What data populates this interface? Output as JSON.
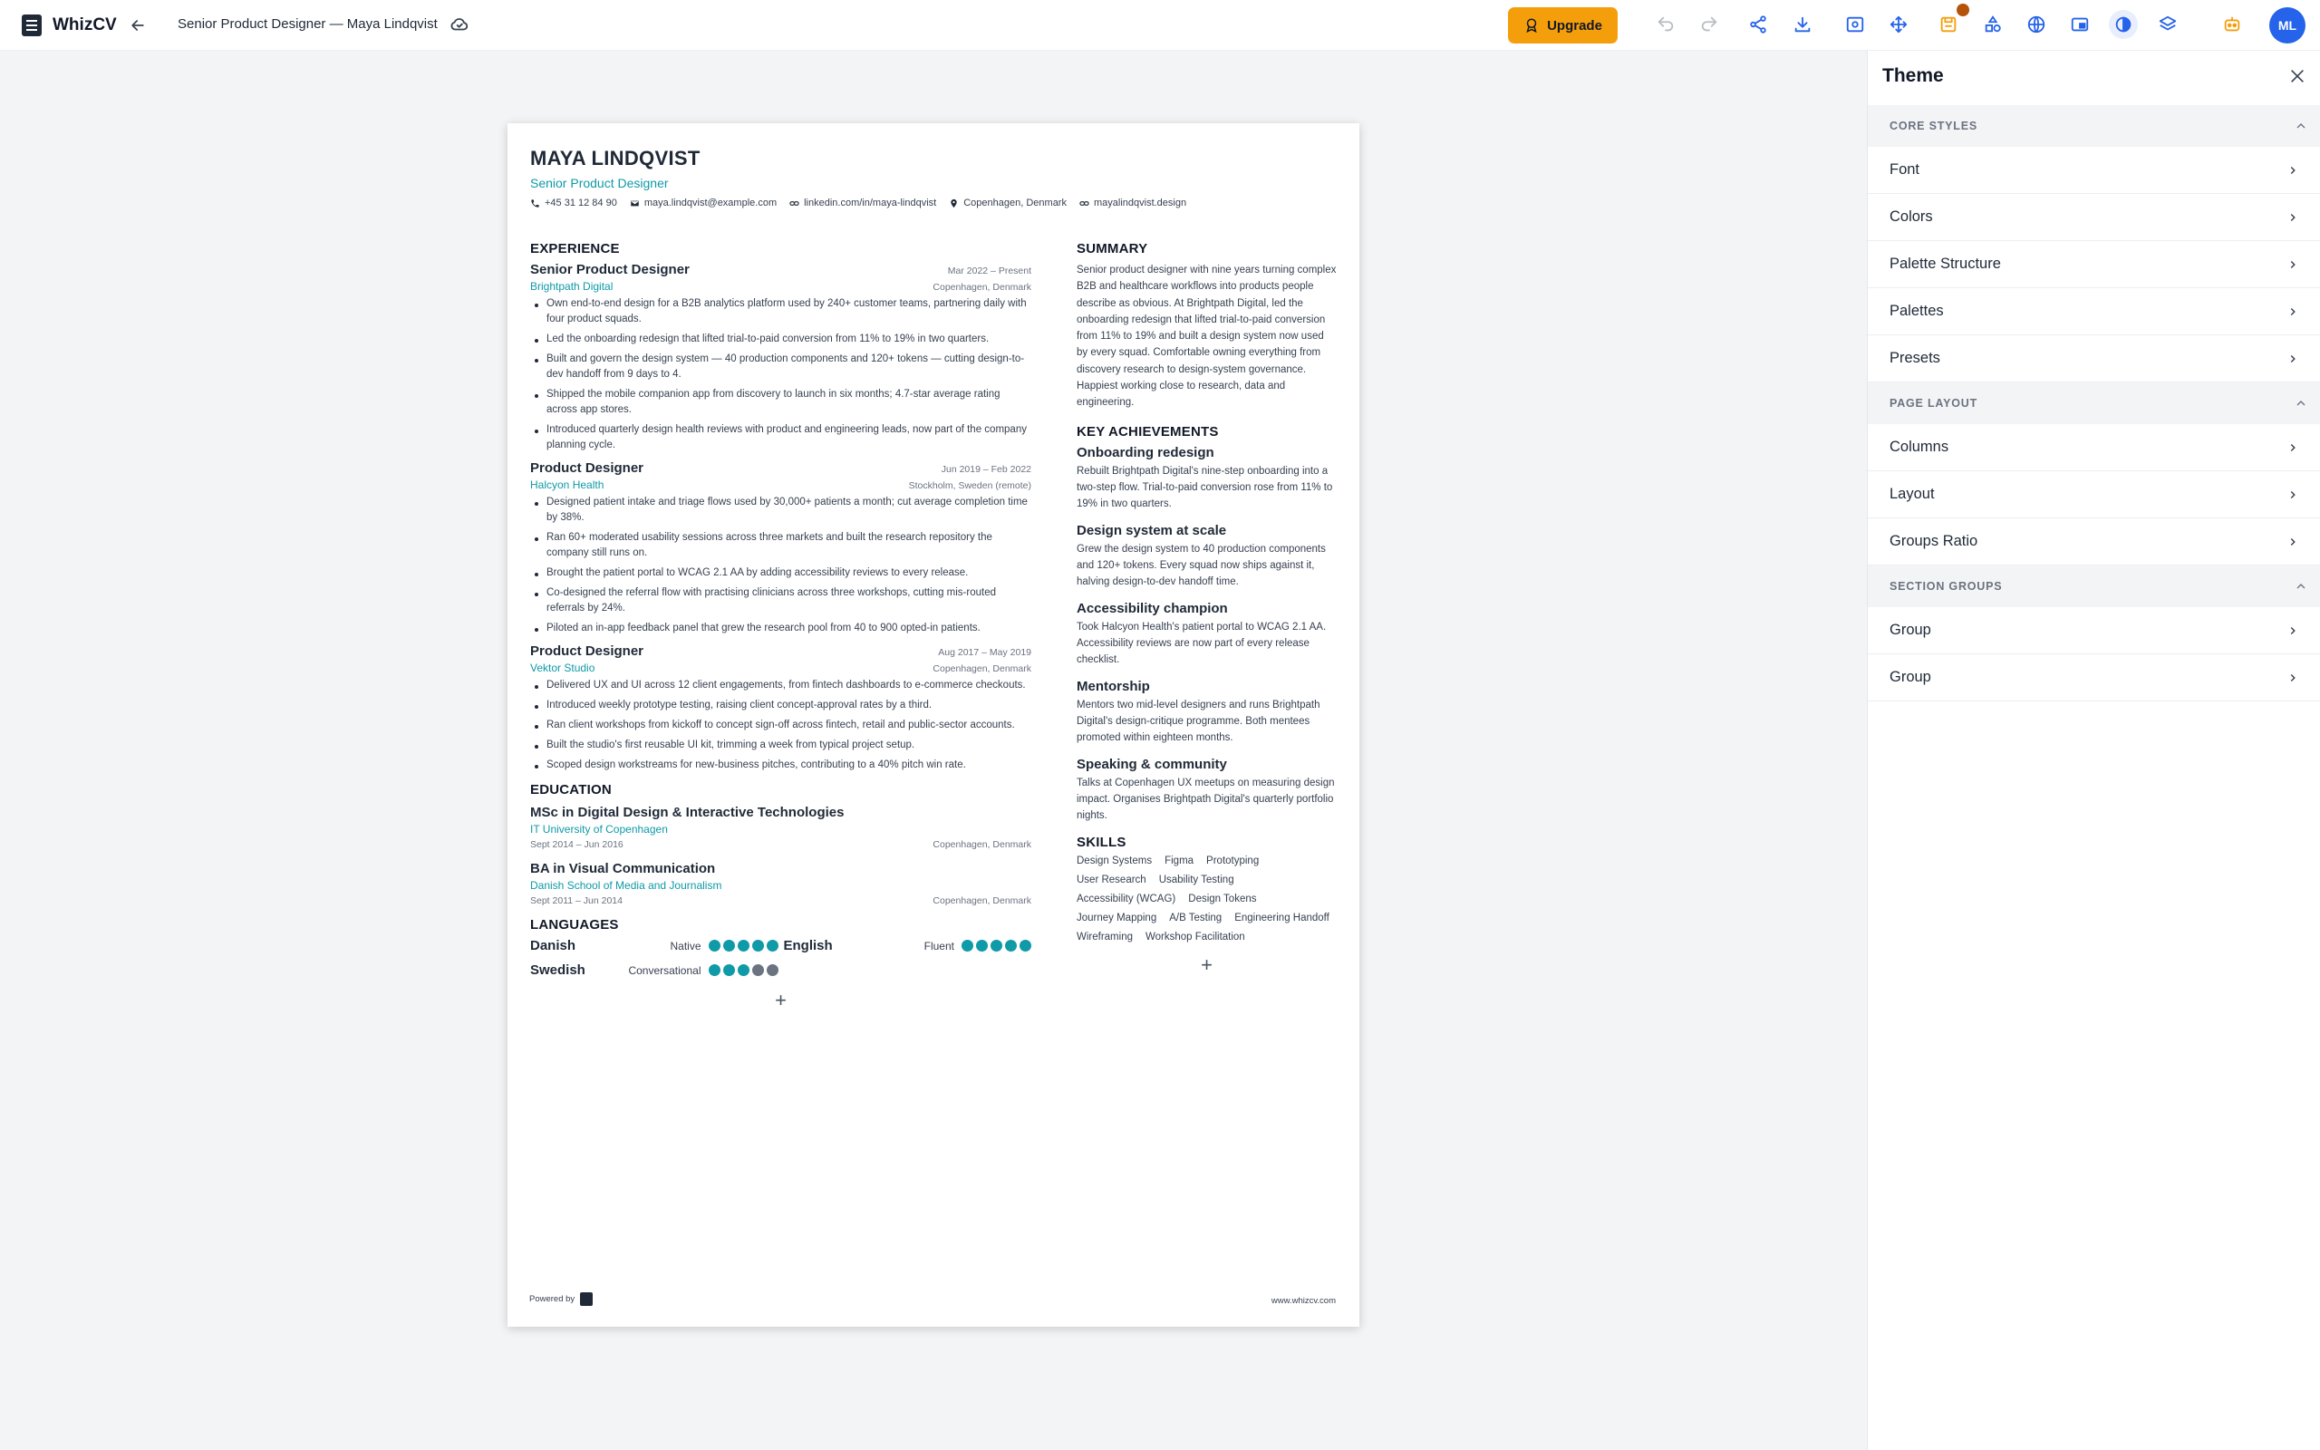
{
  "app": {
    "name": "WhizCV",
    "doc_title": "Senior Product Designer — Maya Lindqvist",
    "upgrade_label": "Upgrade",
    "avatar_initials": "ML"
  },
  "resume": {
    "name": "MAYA LINDQVIST",
    "role": "Senior Product Designer",
    "contacts": [
      {
        "icon": "phone-icon",
        "text": "+45 31 12 84 90"
      },
      {
        "icon": "mail-icon",
        "text": "maya.lindqvist@example.com"
      },
      {
        "icon": "link-icon",
        "text": "linkedin.com/in/maya-lindqvist"
      },
      {
        "icon": "location-icon",
        "text": "Copenhagen, Denmark"
      },
      {
        "icon": "link-icon",
        "text": "mayalindqvist.design"
      }
    ],
    "experience": {
      "title": "EXPERIENCE",
      "jobs": [
        {
          "title": "Senior Product Designer",
          "date": "Mar 2022 – Present",
          "company": "Brightpath Digital",
          "location": "Copenhagen, Denmark",
          "bullets": [
            "Own end-to-end design for a B2B analytics platform used by 240+ customer teams, partnering daily with four product squads.",
            "Led the onboarding redesign that lifted trial-to-paid conversion from 11% to 19% in two quarters.",
            "Built and govern the design system — 40 production components and 120+ tokens — cutting design-to-dev handoff from 9 days to 4.",
            "Shipped the mobile companion app from discovery to launch in six months; 4.7-star average rating across app stores.",
            "Introduced quarterly design health reviews with product and engineering leads, now part of the company planning cycle."
          ]
        },
        {
          "title": "Product Designer",
          "date": "Jun 2019 – Feb 2022",
          "company": "Halcyon Health",
          "location": "Stockholm, Sweden (remote)",
          "bullets": [
            "Designed patient intake and triage flows used by 30,000+ patients a month; cut average completion time by 38%.",
            "Ran 60+ moderated usability sessions across three markets and built the research repository the company still runs on.",
            "Brought the patient portal to WCAG 2.1 AA by adding accessibility reviews to every release.",
            "Co-designed the referral flow with practising clinicians across three workshops, cutting mis-routed referrals by 24%.",
            "Piloted an in-app feedback panel that grew the research pool from 40 to 900 opted-in patients."
          ]
        },
        {
          "title": "Product Designer",
          "date": "Aug 2017 – May 2019",
          "company": "Vektor Studio",
          "location": "Copenhagen, Denmark",
          "bullets": [
            "Delivered UX and UI across 12 client engagements, from fintech dashboards to e-commerce checkouts.",
            "Introduced weekly prototype testing, raising client concept-approval rates by a third.",
            "Ran client workshops from kickoff to concept sign-off across fintech, retail and public-sector accounts.",
            "Built the studio's first reusable UI kit, trimming a week from typical project setup.",
            "Scoped design workstreams for new-business pitches, contributing to a 40% pitch win rate."
          ]
        }
      ]
    },
    "education": {
      "title": "EDUCATION",
      "items": [
        {
          "degree": "MSc in Digital Design & Interactive Technologies",
          "school": "IT University of Copenhagen",
          "date": "Sept 2014 – Jun 2016",
          "location": "Copenhagen, Denmark"
        },
        {
          "degree": "BA in Visual Communication",
          "school": "Danish School of Media and Journalism",
          "date": "Sept 2011 – Jun 2014",
          "location": "Copenhagen, Denmark"
        }
      ]
    },
    "languages": {
      "title": "LANGUAGES",
      "items": [
        {
          "name": "Danish",
          "level": "Native",
          "rating": 5
        },
        {
          "name": "English",
          "level": "Fluent",
          "rating": 5
        },
        {
          "name": "Swedish",
          "level": "Conversational",
          "rating": 3
        }
      ]
    },
    "summary": {
      "title": "SUMMARY",
      "text": "Senior product designer with nine years turning complex B2B and healthcare workflows into products people describe as obvious. At Brightpath Digital, led the onboarding redesign that lifted trial-to-paid conversion from 11% to 19% and built a design system now used by every squad. Comfortable owning everything from discovery research to design-system governance. Happiest working close to research, data and engineering."
    },
    "achievements": {
      "title": "KEY ACHIEVEMENTS",
      "items": [
        {
          "title": "Onboarding redesign",
          "text": "Rebuilt Brightpath Digital's nine-step onboarding into a two-step flow. Trial-to-paid conversion rose from 11% to 19% in two quarters."
        },
        {
          "title": "Design system at scale",
          "text": "Grew the design system to 40 production components and 120+ tokens. Every squad now ships against it, halving design-to-dev handoff time."
        },
        {
          "title": "Accessibility champion",
          "text": "Took Halcyon Health's patient portal to WCAG 2.1 AA. Accessibility reviews are now part of every release checklist."
        },
        {
          "title": "Mentorship",
          "text": "Mentors two mid-level designers and runs Brightpath Digital's design-critique programme. Both mentees promoted within eighteen months."
        },
        {
          "title": "Speaking & community",
          "text": "Talks at Copenhagen UX meetups on measuring design impact. Organises Brightpath Digital's quarterly portfolio nights."
        }
      ]
    },
    "skills": {
      "title": "SKILLS",
      "items": [
        "Design Systems",
        "Figma",
        "Prototyping",
        "User Research",
        "Usability Testing",
        "Accessibility (WCAG)",
        "Design Tokens",
        "Journey Mapping",
        "A/B Testing",
        "Engineering Handoff",
        "Wireframing",
        "Workshop Facilitation"
      ]
    },
    "footer": {
      "powered_by": "Powered by",
      "site": "www.whizcv.com"
    },
    "add_glyph": "+"
  },
  "panel": {
    "title": "Theme",
    "groups": [
      {
        "label": "CORE STYLES",
        "items": [
          "Font",
          "Colors",
          "Palette Structure",
          "Palettes",
          "Presets"
        ]
      },
      {
        "label": "PAGE LAYOUT",
        "items": [
          "Columns",
          "Layout",
          "Groups Ratio"
        ]
      },
      {
        "label": "SECTION GROUPS",
        "items": [
          "Group",
          "Group"
        ]
      }
    ]
  },
  "colors": {
    "accent": "#0e9aa7",
    "upgrade": "#f59e0b",
    "avatar": "#2563eb",
    "active_icon": "#2563eb"
  }
}
